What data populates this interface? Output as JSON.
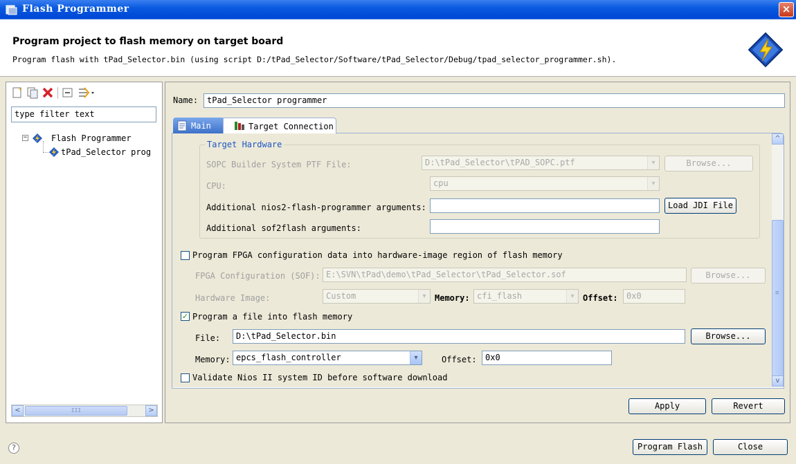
{
  "window": {
    "title": "Flash Programmer",
    "close_glyph": "×",
    "icon": "flash-programmer-icon"
  },
  "header": {
    "title": "Program project to flash memory on target board",
    "description": "Program flash with tPad_Selector.bin (using script D:/tPad_Selector/Software/tPad_Selector/Debug/tpad_selector_programmer.sh).",
    "icon": "lightning-chip-icon"
  },
  "left": {
    "toolbar": [
      "new-config-icon",
      "duplicate-icon",
      "delete-icon",
      "collapse-all-icon",
      "filter-icon"
    ],
    "filter_value": "type filter text",
    "tree": {
      "root": "Flash Programmer",
      "root_expander": "−",
      "child": "tPad_Selector prog"
    },
    "scroll_left": "<",
    "scroll_right": ">",
    "scroll_grip": "III"
  },
  "form": {
    "name_label": "Name:",
    "name_value": "tPad_Selector programmer",
    "tabs": [
      {
        "label": "Main",
        "icon": "main-tab-icon",
        "active": true
      },
      {
        "label": "Target Connection",
        "icon": "target-connection-icon",
        "active": false
      }
    ],
    "target_hardware": {
      "group_title": "Target Hardware",
      "ptf_label": "SOPC Builder System PTF File:",
      "ptf_value": "D:\\tPad_Selector\\tPAD_SOPC.ptf",
      "browse_label": "Browse...",
      "cpu_label": "CPU:",
      "cpu_value": "cpu",
      "flash_args_label": "Additional nios2-flash-programmer arguments:",
      "flash_args_value": "",
      "load_jdi_label": "Load JDI File",
      "sof2flash_label": "Additional sof2flash arguments:",
      "sof2flash_value": ""
    },
    "fpga": {
      "checkbox_label": "Program FPGA configuration data into hardware-image region of flash memory",
      "checked": false,
      "sof_label": "FPGA Configuration (SOF):",
      "sof_value": "E:\\SVN\\tPad\\demo\\tPad_Selector\\tPad_Selector.sof",
      "browse_label": "Browse...",
      "hw_image_label": "Hardware Image:",
      "hw_image_value": "Custom",
      "memory_label": "Memory:",
      "memory_value": "cfi_flash",
      "offset_label": "Offset:",
      "offset_value": "0x0"
    },
    "file_prog": {
      "checkbox_label": "Program a file into flash memory",
      "checked": true,
      "check_glyph": "✓",
      "file_label": "File:",
      "file_value": "D:\\tPad_Selector.bin",
      "browse_label": "Browse...",
      "memory_label": "Memory:",
      "memory_value": "epcs_flash_controller",
      "offset_label": "Offset:",
      "offset_value": "0x0"
    },
    "validate": {
      "checkbox_label": "Validate Nios II system ID before software download",
      "checked": false
    },
    "dropdown_glyph": "▾",
    "scroll_up": "^",
    "scroll_down": "v",
    "scroll_grip": "≡",
    "apply_label": "Apply",
    "revert_label": "Revert"
  },
  "footer": {
    "help_glyph": "?",
    "program_flash_label": "Program Flash",
    "close_label": "Close"
  },
  "colors": {
    "titlebar": "#0a5be0",
    "group_title": "#1f56c4",
    "window_bg": "#ece9d8"
  }
}
